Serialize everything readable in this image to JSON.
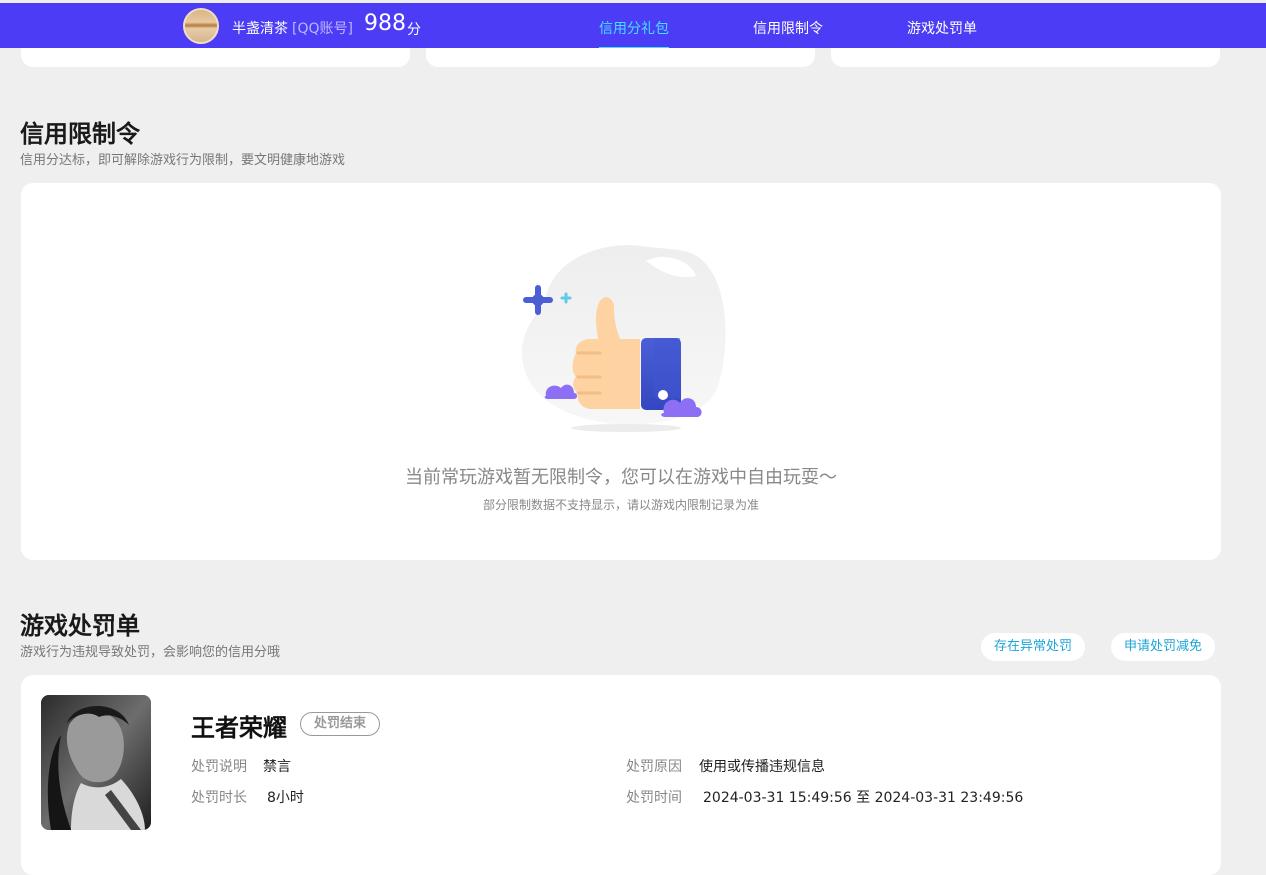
{
  "header": {
    "username": "半盏清茶",
    "account_type": "[QQ账号]",
    "score": "988",
    "score_unit": "分",
    "tabs": [
      {
        "label": "信用分礼包",
        "active": true
      },
      {
        "label": "信用限制令",
        "active": false
      },
      {
        "label": "游戏处罚单",
        "active": false
      }
    ]
  },
  "restriction": {
    "title": "信用限制令",
    "subtitle": "信用分达标，即可解除游戏行为限制，要文明健康地游戏",
    "empty_message": "当前常玩游戏暂无限制令，您可以在游戏中自由玩耍～",
    "empty_note": "部分限制数据不支持显示，请以游戏内限制记录为准"
  },
  "penalty": {
    "title": "游戏处罚单",
    "subtitle": "游戏行为违规导致处罚，会影响您的信用分哦",
    "actions": [
      "存在异常处罚",
      "申请处罚减免"
    ],
    "item": {
      "game": "王者荣耀",
      "status": "处罚结束",
      "desc_label": "处罚说明",
      "desc_value": "禁言",
      "reason_label": "处罚原因",
      "reason_value": "使用或传播违规信息",
      "duration_label": "处罚时长",
      "duration_value": "8小时",
      "time_label": "处罚时间",
      "time_value": "2024-03-31 15:49:56 至 2024-03-31 23:49:56"
    }
  },
  "colors": {
    "header_bg": "#4c3cf5",
    "active_tab": "#43e0ff",
    "pill_text": "#1ca5d7",
    "page_bg": "#efefef"
  }
}
